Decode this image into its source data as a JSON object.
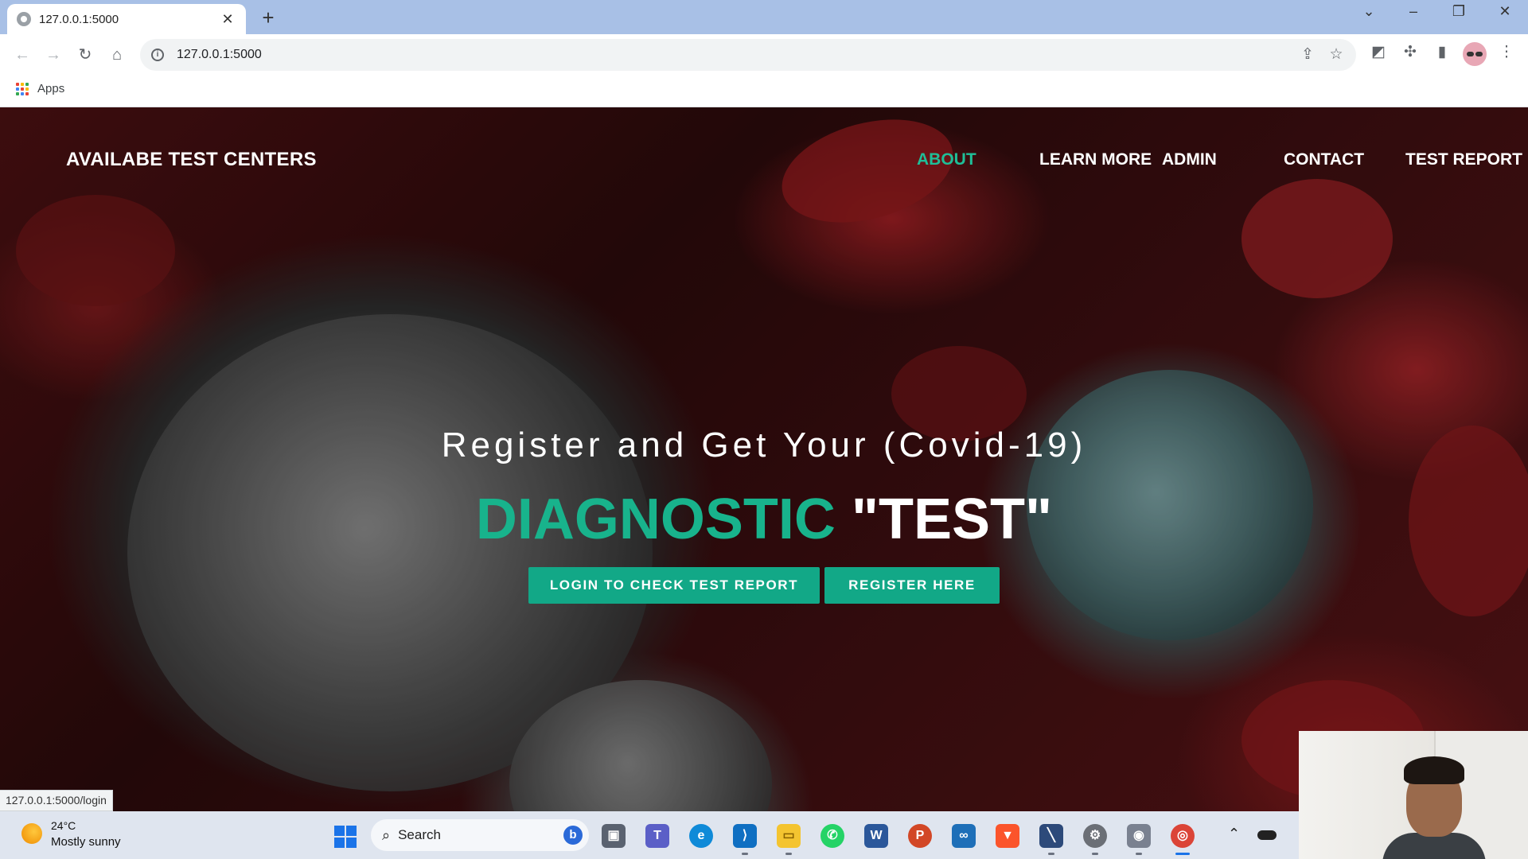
{
  "browser": {
    "tab_title": "127.0.0.1:5000",
    "url": "127.0.0.1:5000",
    "bookmark_apps": "Apps"
  },
  "site": {
    "brand": "AVAILABE TEST CENTERS",
    "nav": [
      "ABOUT",
      "LEARN MORE",
      "ADMIN",
      "CONTACT",
      "TEST REPORT"
    ],
    "active_nav": "ABOUT",
    "tagline": "Register and Get Your (Covid-19)",
    "headline_accent": "DIAGNOSTIC",
    "headline_main": "\"TEST\"",
    "login_button": "LOGIN TO CHECK TEST REPORT",
    "register_button": "REGISTER HERE",
    "status_url": "127.0.0.1:5000/login"
  },
  "taskbar": {
    "temperature": "24°C",
    "weather": "Mostly sunny",
    "search_label": "Search",
    "apps": [
      "file-explorer-multitask",
      "teams",
      "edge",
      "vscode",
      "file-explorer",
      "whatsapp",
      "word",
      "powerpoint",
      "infinity-app",
      "brave",
      "terminal-app",
      "settings-app",
      "camera",
      "chrome"
    ]
  },
  "colors": {
    "accent": "#18b38c",
    "button": "#12a887",
    "nav_active": "#1fbf98"
  }
}
